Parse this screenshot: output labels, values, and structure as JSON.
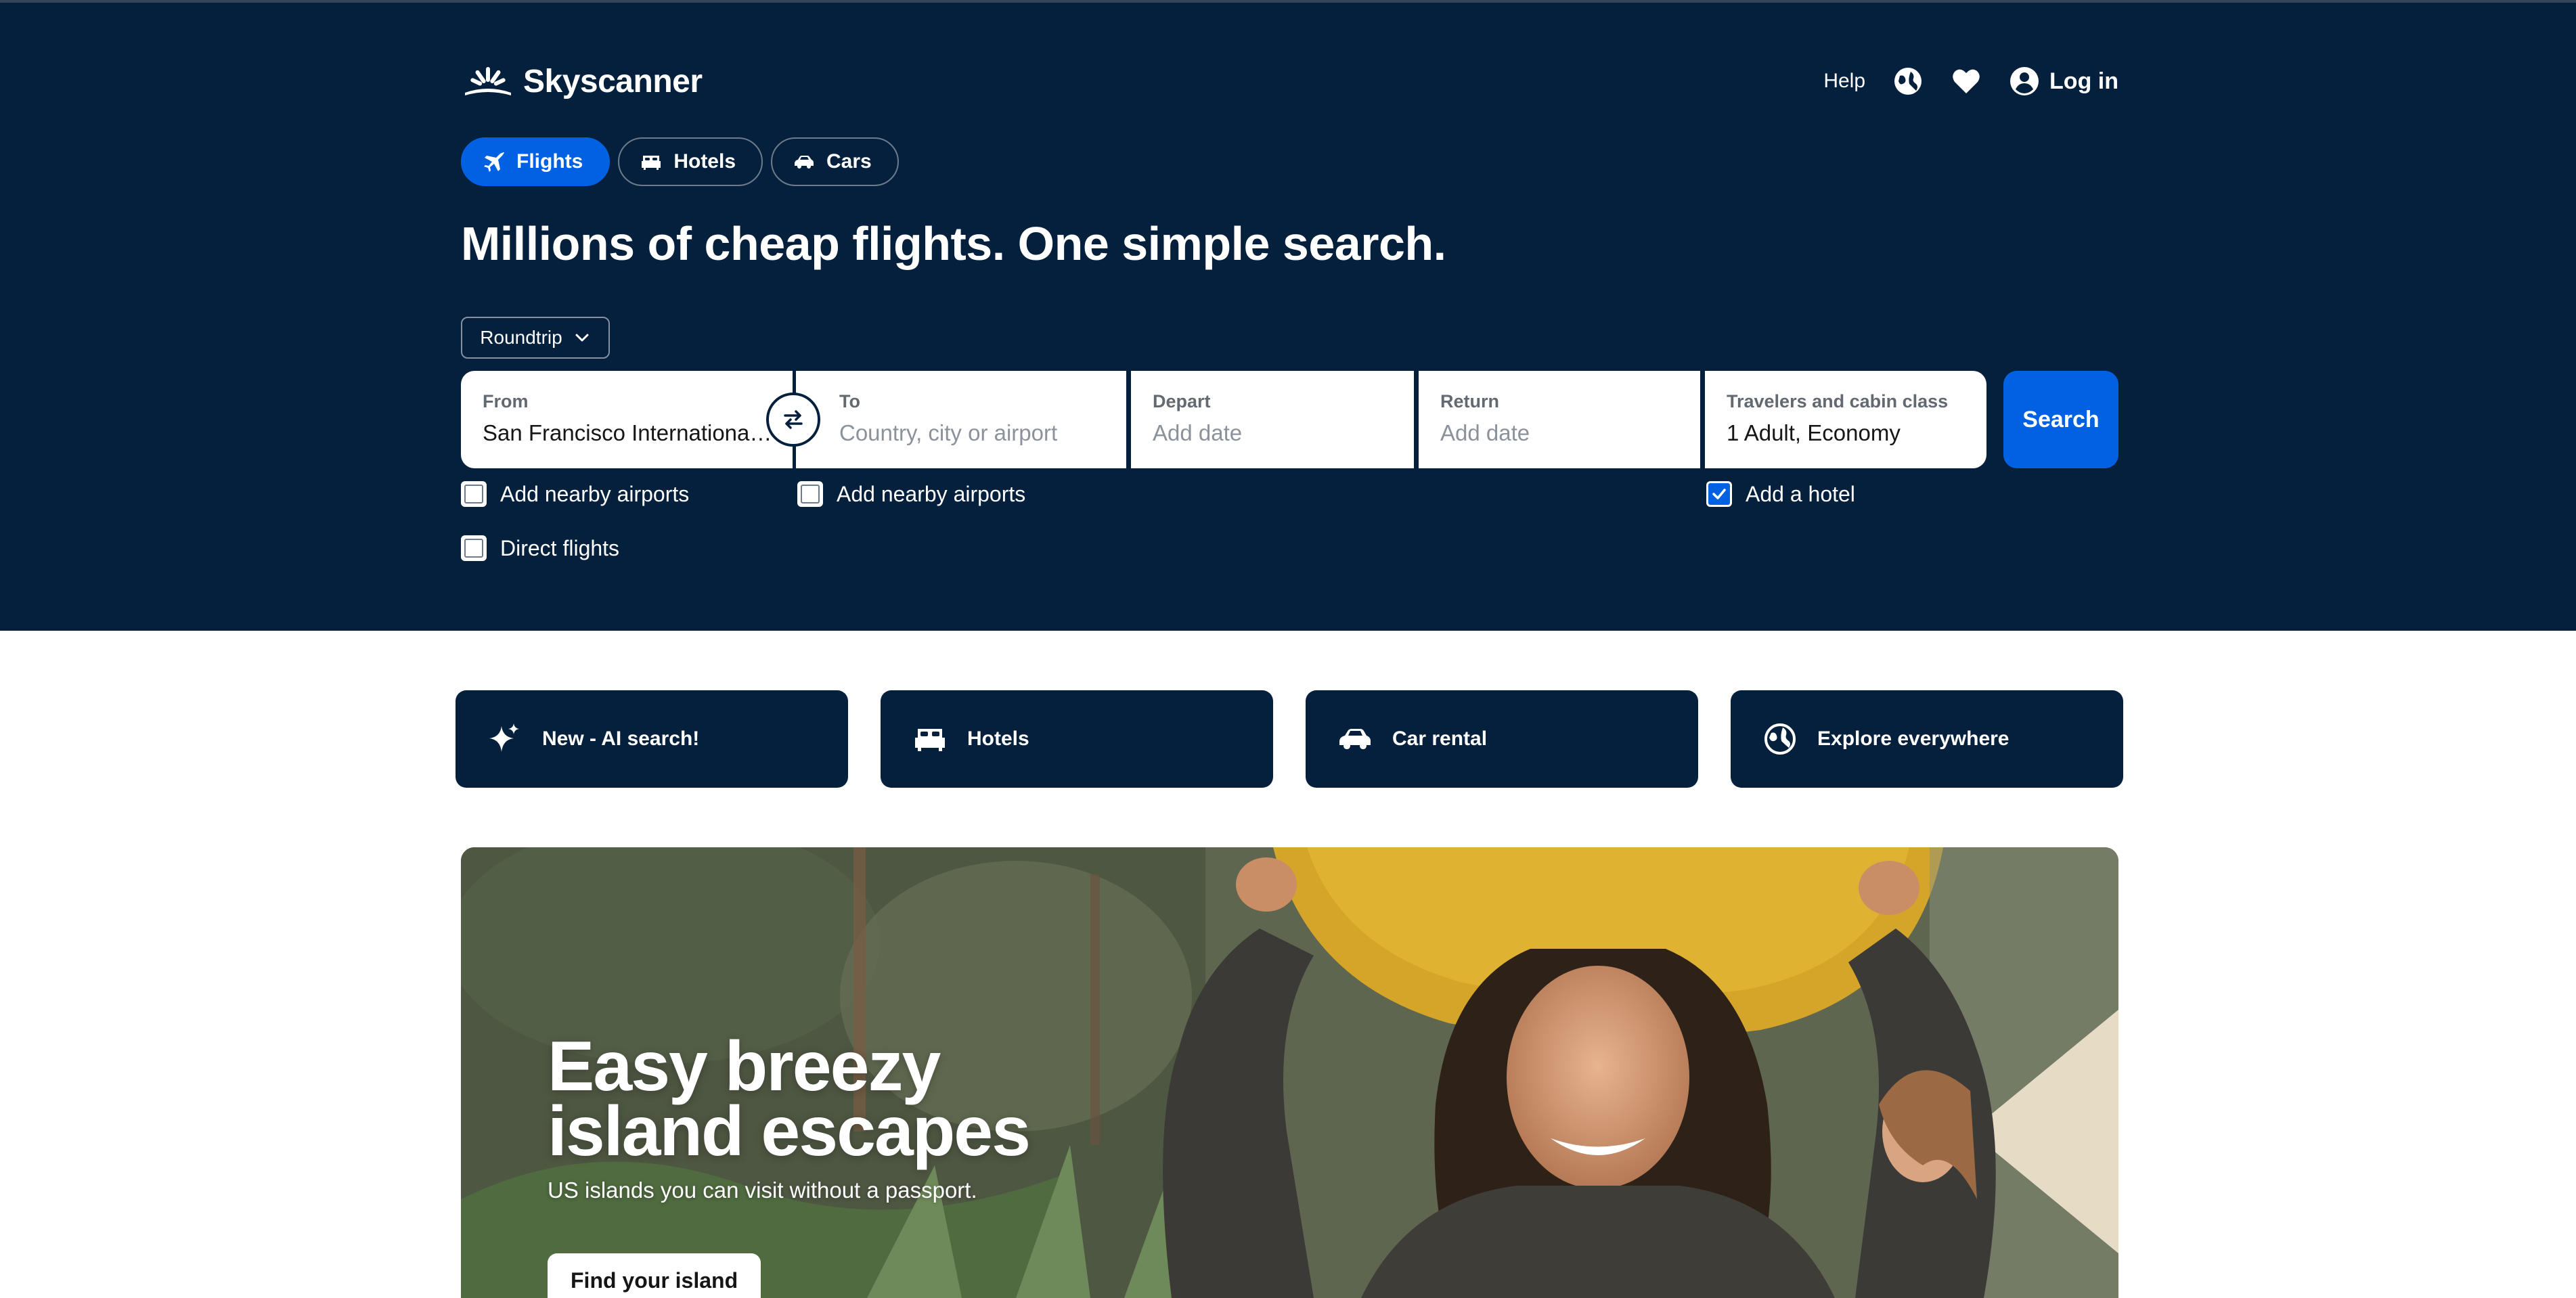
{
  "brand": {
    "name": "Skyscanner"
  },
  "topnav": {
    "help": "Help",
    "login": "Log in"
  },
  "tabs": [
    {
      "label": "Flights",
      "icon": "plane-icon",
      "active": true
    },
    {
      "label": "Hotels",
      "icon": "bed-icon",
      "active": false
    },
    {
      "label": "Cars",
      "icon": "car-icon",
      "active": false
    }
  ],
  "headline": "Millions of cheap flights. One simple search.",
  "trip_type": {
    "selected": "Roundtrip"
  },
  "search": {
    "from": {
      "label": "From",
      "value": "San Francisco International ..."
    },
    "to": {
      "label": "To",
      "placeholder": "Country, city or airport"
    },
    "depart": {
      "label": "Depart",
      "placeholder": "Add date"
    },
    "return": {
      "label": "Return",
      "placeholder": "Add date"
    },
    "travelers": {
      "label": "Travelers and cabin class",
      "value": "1 Adult, Economy"
    },
    "button": "Search"
  },
  "options": {
    "from_nearby": {
      "label": "Add nearby airports",
      "checked": false
    },
    "to_nearby": {
      "label": "Add nearby airports",
      "checked": false
    },
    "add_hotel": {
      "label": "Add a hotel",
      "checked": true
    },
    "direct": {
      "label": "Direct flights",
      "checked": false
    }
  },
  "quick_links": [
    {
      "label": "New - AI search!",
      "icon": "sparkle-icon"
    },
    {
      "label": "Hotels",
      "icon": "bed-icon"
    },
    {
      "label": "Car rental",
      "icon": "car-icon"
    },
    {
      "label": "Explore everywhere",
      "icon": "globe-icon"
    }
  ],
  "hero": {
    "title_line1": "Easy breezy",
    "title_line2": "island escapes",
    "subtitle": "US islands you can visit without a passport.",
    "cta": "Find your island"
  },
  "colors": {
    "header_bg": "#05203c",
    "accent": "#0062e3",
    "card_bg": "#05203c"
  }
}
